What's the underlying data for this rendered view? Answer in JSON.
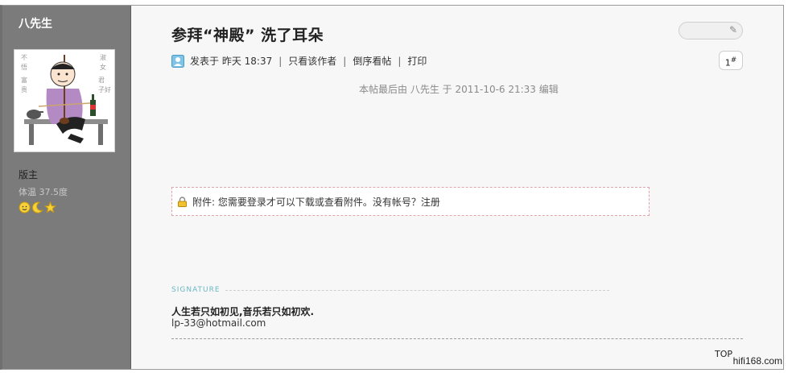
{
  "author": {
    "name": "八先生",
    "role": "版主",
    "temperature": "体温 37.5度"
  },
  "post": {
    "title": "参拜“神殿”  洗了耳朵",
    "meta": {
      "posted": "发表于 昨天 18:37",
      "only_author": "只看该作者",
      "reverse_order": "倒序看帖",
      "print": "打印",
      "separator": "|"
    },
    "floor": "1",
    "floor_suffix": "#",
    "edited_note": "本帖最后由 八先生 于 2011-10-6 21:33 编辑",
    "attachment": {
      "text": "附件: 您需要登录才可以下载或查看附件。没有帐号？",
      "register": "注册"
    },
    "signature": {
      "label": "SIGNATURE",
      "line1": "人生若只如初见,音乐若只如初欢.",
      "email": "lp-33@hotmail.com"
    },
    "top_link": "TOP"
  },
  "watermark": "hifi168.com",
  "icons": {
    "user": "user-icon",
    "lock": "lock-icon",
    "medals": [
      "sun-medal-icon",
      "moon-medal-icon",
      "star-medal-icon"
    ]
  },
  "colors": {
    "sidebar": "#7b7b7b",
    "attachment_border": "#e2a3ad",
    "signature_label": "#6bb7c2"
  }
}
